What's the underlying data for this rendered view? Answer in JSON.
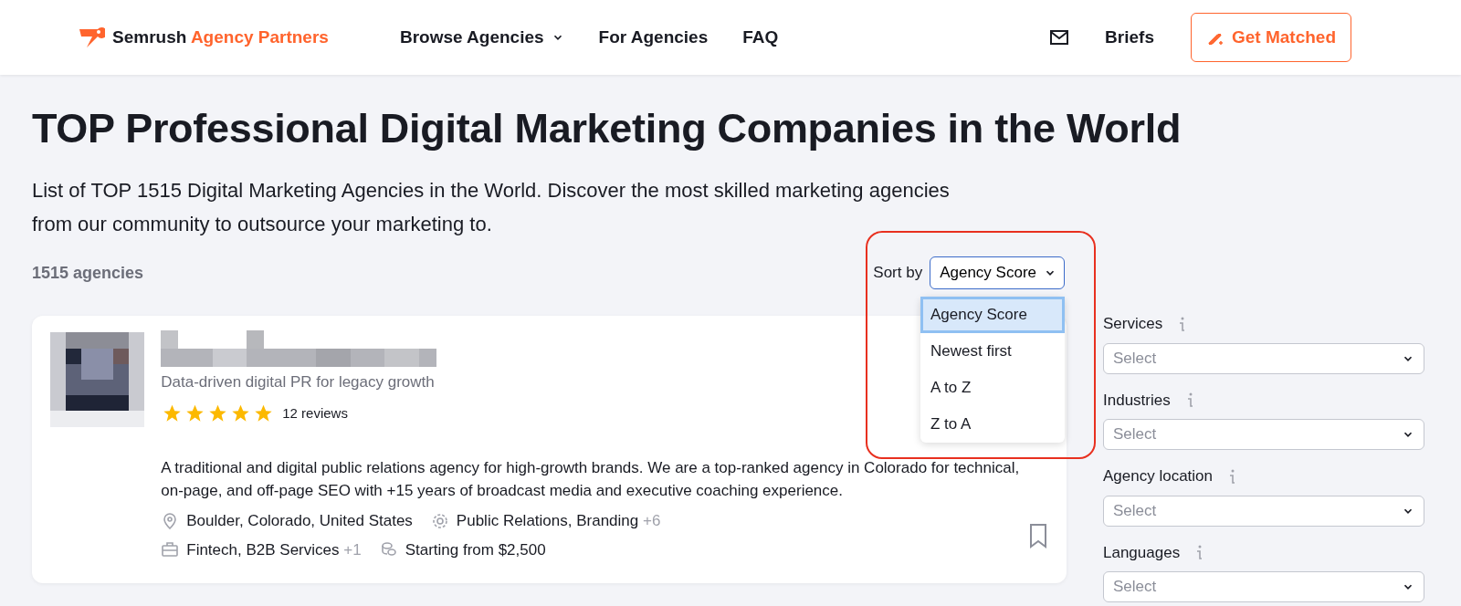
{
  "header": {
    "brand": {
      "name": "Semrush",
      "suffix": "Agency Partners"
    },
    "nav": [
      {
        "label": "Browse Agencies",
        "dropdown": true
      },
      {
        "label": "For Agencies",
        "dropdown": false
      },
      {
        "label": "FAQ",
        "dropdown": false
      }
    ],
    "briefs": "Briefs",
    "cta": "Get Matched"
  },
  "title": "TOP Professional Digital Marketing Companies in the World",
  "intro": "List of TOP 1515 Digital Marketing Agencies in the World. Discover the most skilled marketing agencies from our community to outsource your marketing to.",
  "count": "1515 agencies",
  "sort": {
    "label": "Sort by",
    "value": "Agency Score",
    "open": true,
    "options": [
      {
        "label": "Agency Score",
        "selected": true
      },
      {
        "label": "Newest first",
        "selected": false
      },
      {
        "label": "A to Z",
        "selected": false
      },
      {
        "label": "Z to A",
        "selected": false
      }
    ]
  },
  "agency": {
    "tagline": "Data-driven digital PR for legacy growth",
    "stars": 5,
    "reviews": "12 reviews",
    "description": "A traditional and digital public relations agency for high-growth brands. We are a top-ranked agency in Colorado for technical, on-page, and off-page SEO with +15 years of broadcast media and executive coaching experience.",
    "location": "Boulder, Colorado, United States",
    "services": "Public Relations, Branding",
    "services_more": "+6",
    "industries": "Fintech, B2B Services",
    "industries_more": "+1",
    "price": "Starting from $2,500",
    "bookmarked": false
  },
  "filters": [
    {
      "label": "Services",
      "placeholder": "Select"
    },
    {
      "label": "Industries",
      "placeholder": "Select"
    },
    {
      "label": "Agency location",
      "placeholder": "Select"
    },
    {
      "label": "Languages",
      "placeholder": "Select"
    }
  ]
}
